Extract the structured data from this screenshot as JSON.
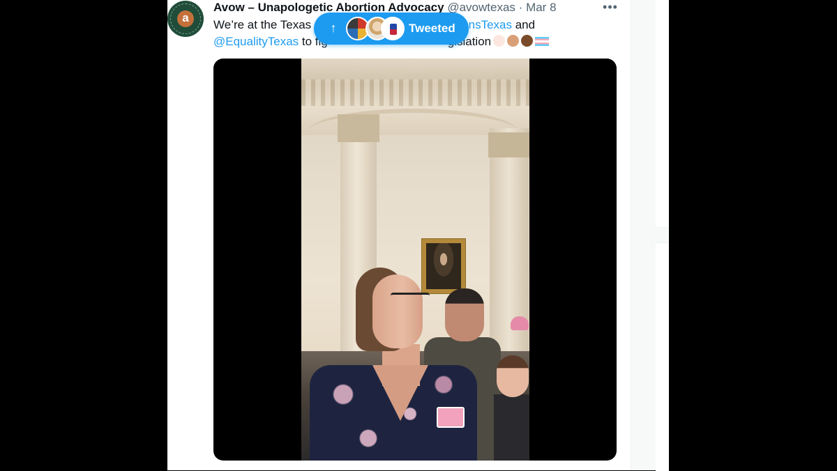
{
  "tweet": {
    "author_name": "Avow – Unapologetic Abortion Advocacy",
    "handle": "@avowtexas",
    "separator": "·",
    "date": "Mar 8",
    "more_glyph": "•••",
    "text_line1_start": "We’re at the Texas",
    "text_line1_link": "ansTexas",
    "text_line1_end": " and",
    "text_line2_link": "@EqualityTexas",
    "text_line2_start": " to fig",
    "text_line2_end": "gislation",
    "emoji_names": [
      "raised-fist-light",
      "raised-fist-medium",
      "raised-fist-dark",
      "transgender-flag"
    ]
  },
  "avatar": {
    "letter": "a",
    "colors": {
      "background": "#1f4d3a",
      "accent": "#c4703a"
    }
  },
  "new_tweets_pill": {
    "label": "Tweeted",
    "arrow_glyph": "↑",
    "avatar_count": 3,
    "color": "#1d9bf0"
  },
  "media": {
    "type": "video",
    "description_icon": "video-player"
  },
  "colors": {
    "link": "#1d9bf0",
    "text": "#0f1419",
    "secondary": "#536471"
  }
}
